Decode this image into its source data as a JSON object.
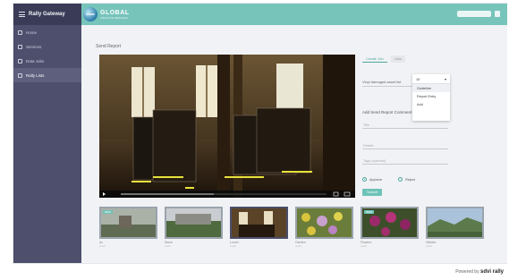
{
  "app": {
    "sidebar_title": "Rally Gateway"
  },
  "sidebar": {
    "items": [
      {
        "label": "Home",
        "icon": "home-icon",
        "active": false
      },
      {
        "label": "Services",
        "icon": "services-icon",
        "active": false
      },
      {
        "label": "Data Jobs",
        "icon": "jobs-icon",
        "active": false
      },
      {
        "label": "Rally Lists",
        "icon": "list-icon",
        "active": true
      }
    ]
  },
  "header": {
    "logo_main": "GLOBAL",
    "logo_sub": "CREATIVE SERVICES"
  },
  "main": {
    "breadcrumb": "Send Report",
    "panel": {
      "tabs": [
        "Create Job",
        "Jobs"
      ],
      "select_value": "Vinyl damaged asset list",
      "dropdown": {
        "selected": "10",
        "items": [
          "Guideline",
          "Report Entry",
          "Add"
        ]
      },
      "form_title": "Add Send Report Comment",
      "inputs": [
        "Title",
        "Details",
        "Tags (optional)"
      ],
      "radios": [
        {
          "label": "Approve",
          "checked": true
        },
        {
          "label": "Reject",
          "checked": false
        }
      ],
      "submit_label": "Submit"
    },
    "thumbnails": [
      {
        "badge": "NEW",
        "caption": "Ac",
        "sub": "Audit"
      },
      {
        "badge": "",
        "caption": "Stone",
        "sub": "Audit"
      },
      {
        "badge": "",
        "caption": "Lunch",
        "sub": "Audit"
      },
      {
        "badge": "",
        "caption": "Garden",
        "sub": "Audit"
      },
      {
        "badge": "NEW",
        "caption": "Flowers",
        "sub": "Audit"
      },
      {
        "badge": "",
        "caption": "Hillside",
        "sub": "Audit"
      }
    ]
  },
  "footer": {
    "powered": "Powered by",
    "brand": "sdvi rally"
  },
  "colors": {
    "sidebar": "#4d4f6c",
    "header": "#77c4bb",
    "accent": "#6ec2b7"
  }
}
